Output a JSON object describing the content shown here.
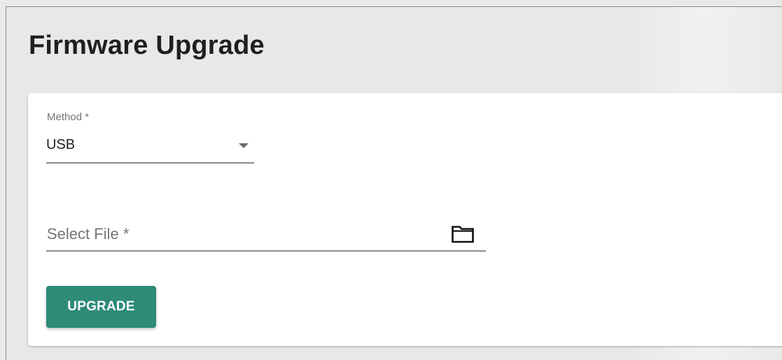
{
  "header": {
    "title": "Firmware Upgrade"
  },
  "form": {
    "method": {
      "label": "Method *",
      "value": "USB",
      "icon": "dropdown-arrow-icon"
    },
    "file": {
      "placeholder": "Select File *",
      "value": "",
      "icon": "folder-icon"
    },
    "upgrade_button": {
      "label": "UPGRADE"
    }
  },
  "colors": {
    "primary": "#2e8b78",
    "page_background": "#e9e9e9",
    "card_background": "#ffffff",
    "text": "#222222",
    "label": "#757575"
  }
}
